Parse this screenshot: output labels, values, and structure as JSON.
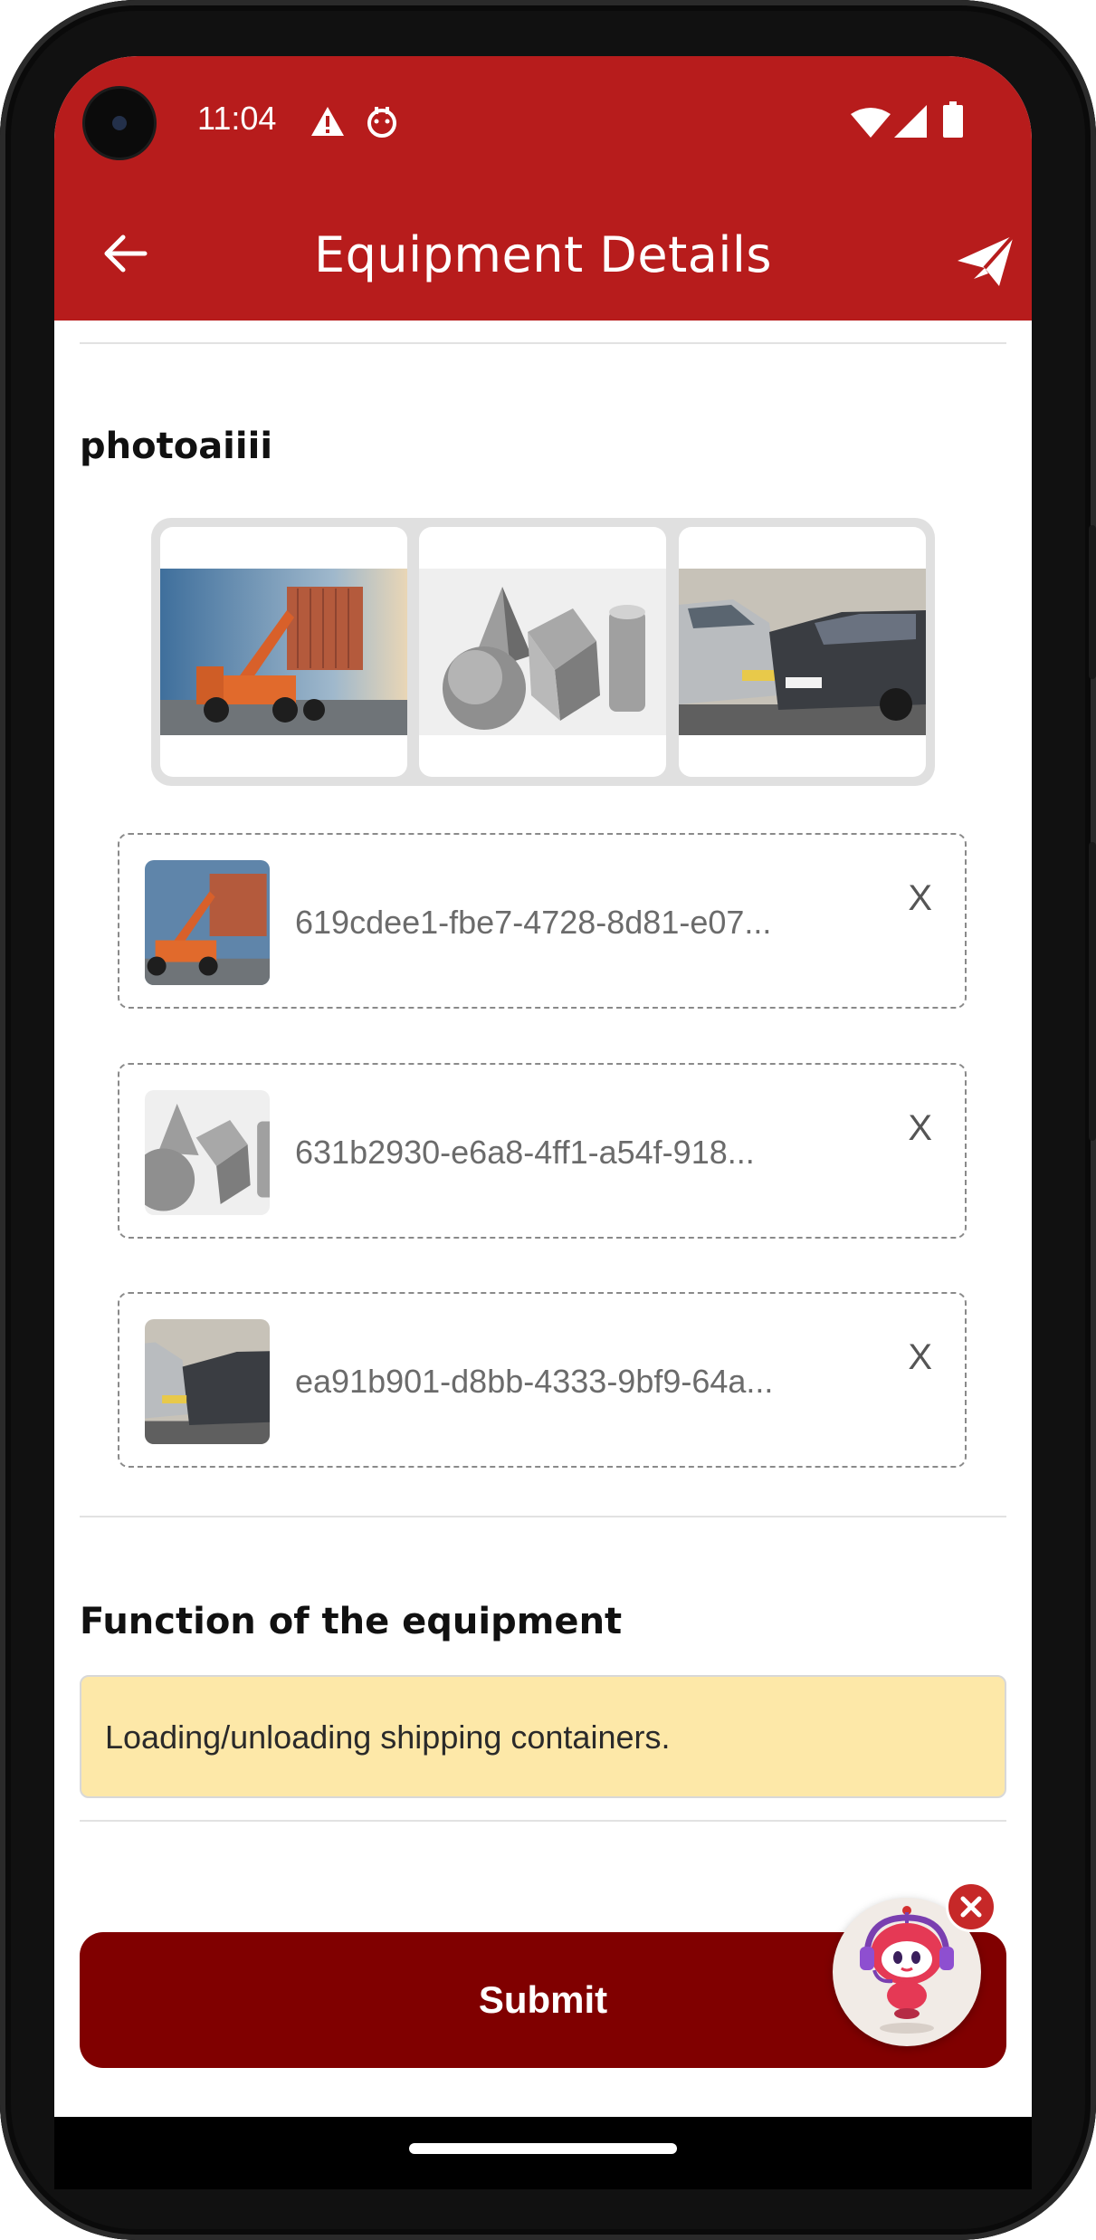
{
  "status_bar": {
    "time": "11:04",
    "icons": [
      "warning-icon",
      "notification-app-icon",
      "wifi-icon",
      "cellular-signal-icon",
      "battery-icon"
    ]
  },
  "app_bar": {
    "title": "Equipment Details",
    "back_icon": "arrow-left-icon",
    "send_icon": "paper-plane-icon",
    "color": "#b71c1c"
  },
  "photos": {
    "label": "photoaiiii",
    "gallery": [
      {
        "name": "container-crane-photo"
      },
      {
        "name": "geometric-shapes-sketch"
      },
      {
        "name": "car-collision-photo"
      }
    ],
    "files": [
      {
        "name": "619cdee1-fbe7-4728-8d81-e07...",
        "remove_label": "X",
        "thumb": "container-crane-photo"
      },
      {
        "name": "631b2930-e6a8-4ff1-a54f-918...",
        "remove_label": "X",
        "thumb": "geometric-shapes-sketch"
      },
      {
        "name": "ea91b901-d8bb-4333-9bf9-64a...",
        "remove_label": "X",
        "thumb": "car-collision-photo"
      }
    ]
  },
  "function": {
    "label": "Function of the equipment",
    "value": "Loading/unloading shipping containers.",
    "background": "#fde8a8"
  },
  "submit_label": "Submit",
  "submit_color": "#800000",
  "assistant": {
    "icon": "support-robot-icon",
    "close_icon": "close-icon"
  }
}
